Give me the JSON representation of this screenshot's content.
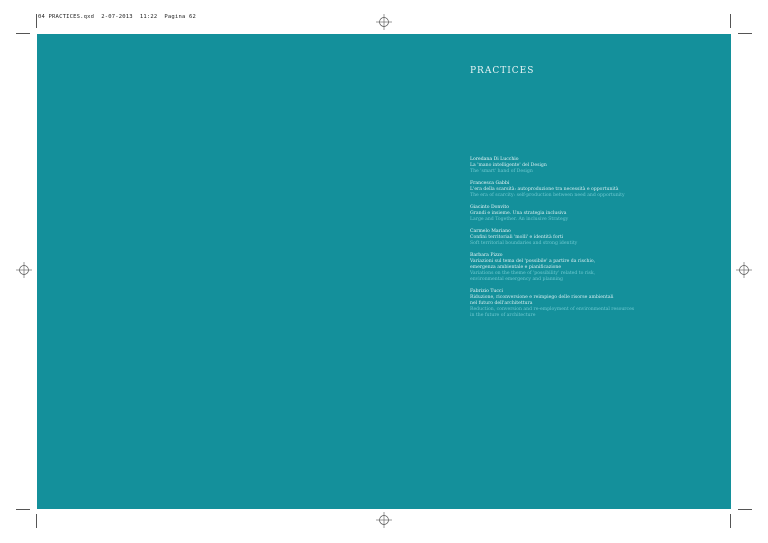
{
  "slug": "04 PRACTICES.qxd  2-07-2013  11:22  Pagina 62",
  "section_title": "PRACTICES",
  "entries": [
    {
      "author": "Loredana Di Lucchio",
      "title_it": [
        "La 'mano intelligente' del Design"
      ],
      "title_en": [
        "The 'smart' hand of Design"
      ]
    },
    {
      "author": "Francesca Gabbi",
      "title_it": [
        "L'era della scarsità: autoproduzione tra necessità e opportunità"
      ],
      "title_en": [
        "The era of scarcity: self-production between need and opportunity"
      ]
    },
    {
      "author": "Giacinto Donvito",
      "title_it": [
        "Grandi e insieme. Una strategia inclusiva"
      ],
      "title_en": [
        "Large and Together. An inclusive Strategy"
      ]
    },
    {
      "author": "Carmelo Mariano",
      "title_it": [
        "Confini territoriali 'molli' e identità forti"
      ],
      "title_en": [
        "Soft territorial boundaries and strong identity"
      ]
    },
    {
      "author": "Barbara Pizzo",
      "title_it": [
        "Variazioni sul tema del 'possibile' a partire da rischio,",
        "emergenza ambientale e pianificazione"
      ],
      "title_en": [
        "Variations on the theme of 'possibility' related to risk,",
        "environmental emergency and planning"
      ]
    },
    {
      "author": "Fabrizio Tucci",
      "title_it": [
        "Riduzione, riconversione e reimpiego delle risorse ambientali",
        "nel futuro dell'architettura"
      ],
      "title_en": [
        "Reduction, conversion and re-employment of environmental resources",
        "in the future of architecture"
      ]
    }
  ]
}
